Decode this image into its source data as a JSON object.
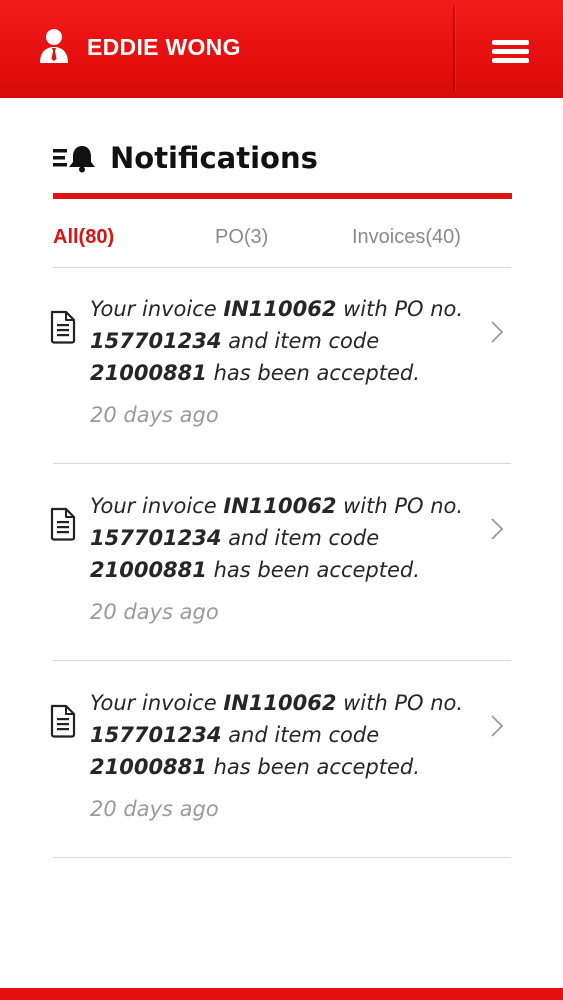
{
  "header": {
    "user_name": "EDDIE WONG",
    "user_icon": "user-icon",
    "menu_icon": "hamburger-menu-icon",
    "background_color": "#e60f0f"
  },
  "page": {
    "title": "Notifications",
    "title_icon": "notification-list-bell-icon",
    "accent_color": "#e11414"
  },
  "tabs": [
    {
      "label": "All(80)",
      "active": true
    },
    {
      "label": "PO(3)",
      "active": false
    },
    {
      "label": "Invoices(40)",
      "active": false
    }
  ],
  "notifications": [
    {
      "icon": "document-icon",
      "text_1": "Your invoice ",
      "invoice": "IN110062",
      "text_2": " with PO no. ",
      "po_number": "157701234",
      "text_3": " and item code ",
      "item_code": "21000881",
      "text_4": " has been accepted.",
      "time": "20 days ago"
    },
    {
      "icon": "document-icon",
      "text_1": "Your invoice ",
      "invoice": "IN110062",
      "text_2": " with PO no. ",
      "po_number": "157701234",
      "text_3": " and item code ",
      "item_code": "21000881",
      "text_4": " has been accepted.",
      "time": "20 days ago"
    },
    {
      "icon": "document-icon",
      "text_1": "Your invoice ",
      "invoice": "IN110062",
      "text_2": " with PO no. ",
      "po_number": "157701234",
      "text_3": " and item code ",
      "item_code": "21000881",
      "text_4": " has been accepted.",
      "time": "20 days ago"
    }
  ]
}
